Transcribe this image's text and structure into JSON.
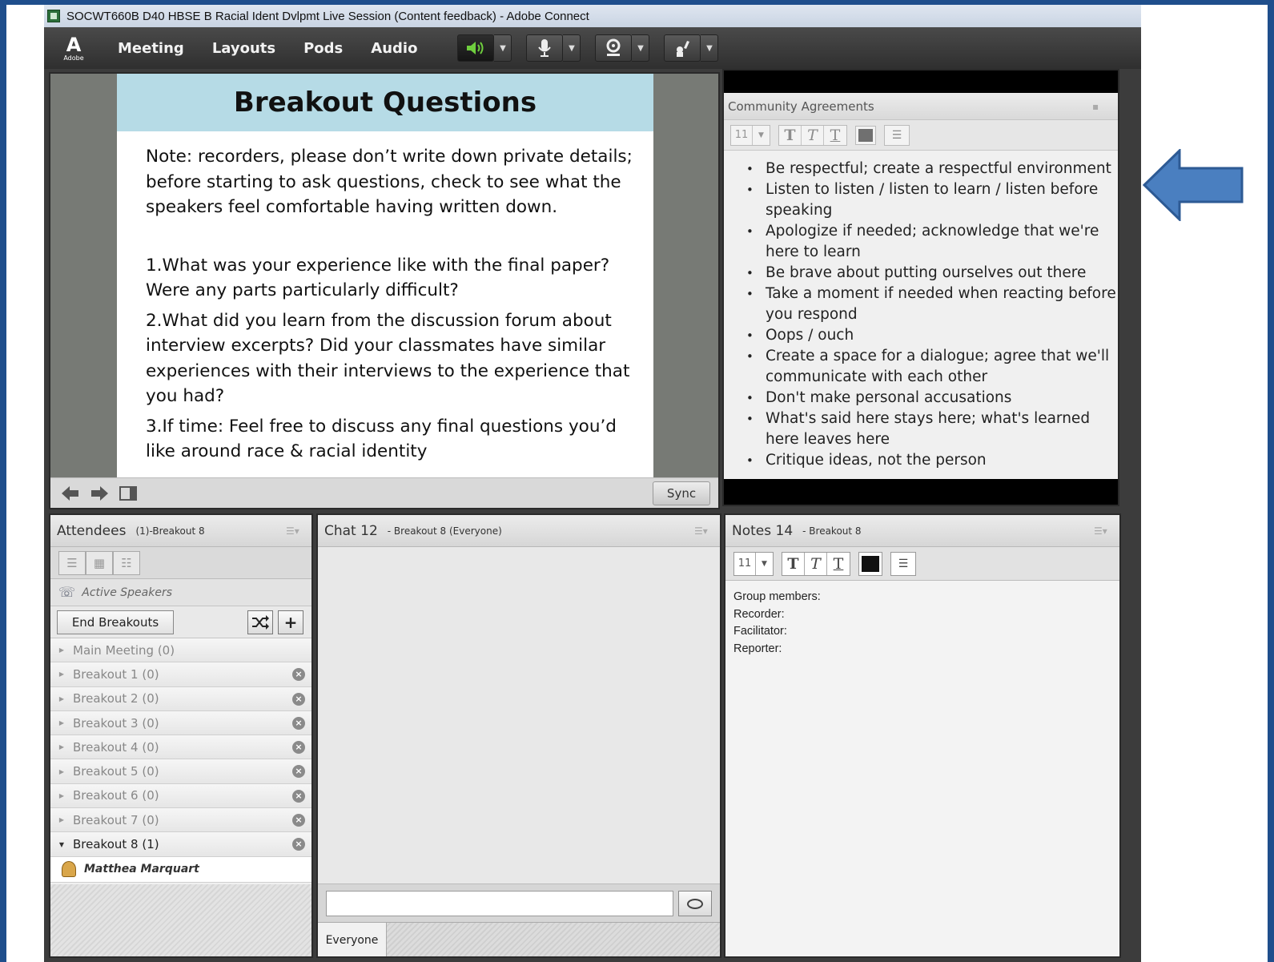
{
  "window": {
    "title": "SOCWT660B D40 HBSE B Racial Ident Dvlpmt Live Session (Content feedback) - Adobe Connect"
  },
  "menubar": {
    "logo_mark": "A",
    "logo_text": "Adobe",
    "items": [
      "Meeting",
      "Layouts",
      "Pods",
      "Audio"
    ]
  },
  "share": {
    "slide_title": "Breakout Questions",
    "note": "Note: recorders, please don’t write down private details; before starting to ask questions, check to see what the speakers feel comfortable having  written down.",
    "questions": [
      "1.What was your experience like with the final paper? Were any parts particularly difficult?",
      "2.What did you learn from the discussion forum about interview excerpts?  Did your classmates have similar experiences with their interviews to the experience that you had?",
      "3.If time:  Feel free to discuss any final questions you’d like around race & racial identity"
    ],
    "sync_label": "Sync"
  },
  "community": {
    "title": "Community Agreements",
    "font_size": "11",
    "items": [
      "Be respectful; create a respectful environment",
      "Listen to listen / listen to learn / listen before speaking",
      "Apologize if needed;  acknowledge that we're here to learn",
      "Be brave about putting ourselves out there",
      "Take a moment if needed when reacting before you respond",
      "Oops / ouch",
      "Create a space for a dialogue;  agree that we'll communicate with each other",
      "Don't make personal accusations",
      "What's said here stays here;  what's learned here leaves here",
      "Critique ideas, not the person"
    ]
  },
  "attendees": {
    "title": "Attendees",
    "subtitle": "(1)-Breakout 8",
    "active_speakers": "Active Speakers",
    "end_breakouts": "End Breakouts",
    "rooms": [
      "Main Meeting (0)",
      "Breakout 1 (0)",
      "Breakout 2 (0)",
      "Breakout 3 (0)",
      "Breakout 4 (0)",
      "Breakout 5 (0)",
      "Breakout 6 (0)",
      "Breakout 7 (0)",
      "Breakout 8 (1)"
    ],
    "attendee": "Matthea Marquart"
  },
  "chat": {
    "title": "Chat 12",
    "subtitle": "- Breakout 8 (Everyone)",
    "tab": "Everyone"
  },
  "notes": {
    "title": "Notes 14",
    "subtitle": "- Breakout 8",
    "font_size": "11",
    "lines": [
      "Group members:",
      "Recorder:",
      "Facilitator:",
      "Reporter:"
    ]
  }
}
